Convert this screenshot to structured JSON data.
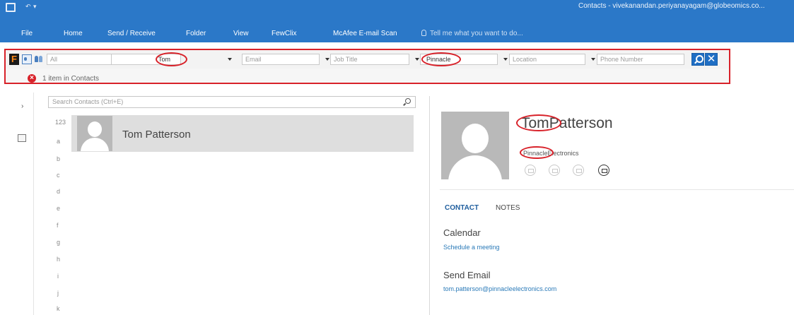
{
  "window": {
    "title": "Contacts - vivekanandan.periyanayagam@globeomics.co..."
  },
  "ribbon": {
    "tabs": [
      "File",
      "Home",
      "Send / Receive",
      "Folder",
      "View",
      "FewClix",
      "McAfee E-mail Scan"
    ],
    "tell_me": "Tell me what you want to do..."
  },
  "fewclix": {
    "scope_value": "All",
    "name_value": "Tom",
    "email_placeholder": "Email",
    "jobtitle_placeholder": "Job Title",
    "company_value": "Pinnacle",
    "location_placeholder": "Location",
    "phone_placeholder": "Phone Number",
    "clear_symbol": "✕",
    "result_count": "1 item in Contacts"
  },
  "contacts": {
    "search_placeholder": "Search Contacts (Ctrl+E)",
    "index": [
      "123",
      "a",
      "b",
      "c",
      "d",
      "e",
      "f",
      "g",
      "h",
      "i",
      "j",
      "k"
    ],
    "items": [
      {
        "name": "Tom Patterson"
      }
    ]
  },
  "detail": {
    "first_name": "Tom",
    "last_name": "Patterson",
    "company_highlight": "Pinnacle",
    "company_rest": "Electronics",
    "tabs": [
      "CONTACT",
      "NOTES"
    ],
    "sections": [
      {
        "heading": "Calendar",
        "link": "Schedule a meeting"
      },
      {
        "heading": "Send Email",
        "link": "tom.patterson@pinnacleelectronics.com"
      }
    ]
  },
  "colors": {
    "ribbon_blue": "#2b78c8",
    "highlight_red": "#d8222a",
    "link_blue": "#2a7ab8"
  }
}
